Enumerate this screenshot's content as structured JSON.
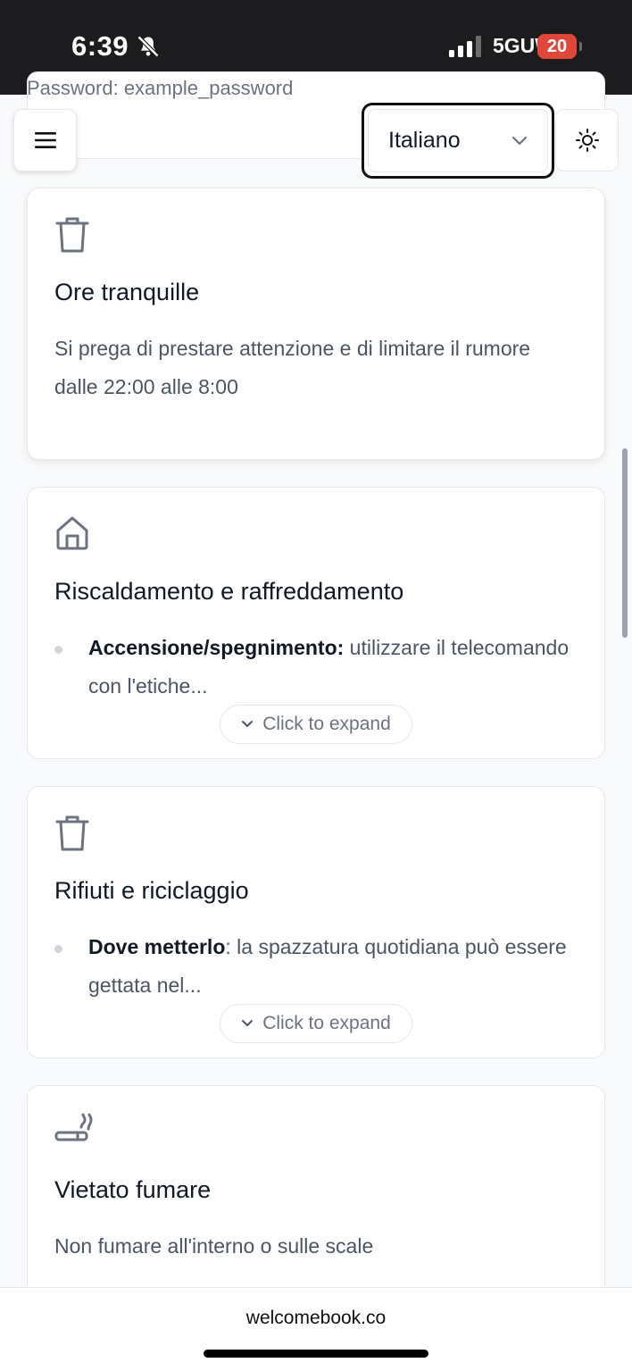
{
  "status_bar": {
    "time": "6:39",
    "network": "5GUW",
    "battery": "20"
  },
  "previous_card": {
    "text": "Password: example_password"
  },
  "header": {
    "language": "Italiano"
  },
  "cards": [
    {
      "icon": "trash-icon",
      "title": "Ore tranquille",
      "body": "Si prega di prestare attenzione e di limitare il rumore dalle 22:00 alle 8:00"
    },
    {
      "icon": "home-icon",
      "title": "Riscaldamento e raffreddamento",
      "bullet_label": "Accensione/spegnimento:",
      "bullet_text": " utilizzare il telecomando con l'etiche...",
      "expand_label": "Click to expand"
    },
    {
      "icon": "trash-icon",
      "title": "Rifiuti e riciclaggio",
      "bullet_label": "Dove metterlo",
      "bullet_text": ": la spazzatura quotidiana può essere gettata nel...",
      "expand_label": "Click to expand"
    },
    {
      "icon": "smoking-icon",
      "title": "Vietato fumare",
      "body": "Non fumare all'interno o sulle scale"
    }
  ],
  "url_bar": {
    "url": "welcomebook.co"
  }
}
